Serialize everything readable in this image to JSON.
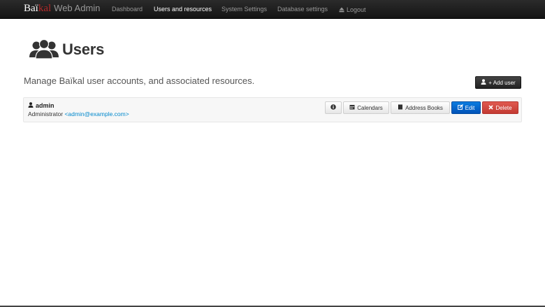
{
  "brand": {
    "part1": "Baï",
    "part2": "kal",
    "sub": "Web Admin"
  },
  "nav": {
    "items": [
      {
        "label": "Dashboard",
        "active": false
      },
      {
        "label": "Users and resources",
        "active": true
      },
      {
        "label": "System Settings",
        "active": false
      },
      {
        "label": "Database settings",
        "active": false
      }
    ],
    "logout": {
      "label": "Logout",
      "icon": "eject-icon"
    }
  },
  "page": {
    "title": "Users",
    "title_icon": "users-icon",
    "lead": "Manage Baïkal user accounts, and associated resources.",
    "add_user_label": "+ Add user",
    "add_user_icon": "user-icon"
  },
  "users": [
    {
      "username": "admin",
      "display_name": "Administrator",
      "email": "<admin@example.com>",
      "actions": {
        "info_icon": "info-icon",
        "calendars": "Calendars",
        "address_books": "Address Books",
        "edit": "Edit",
        "delete": "Delete"
      }
    }
  ],
  "colors": {
    "navbar": "#1b1b1b",
    "brand_accent": "#b22a2a",
    "link": "#0088cc",
    "edit_button": "#0066cc",
    "delete_button": "#d24a40"
  }
}
